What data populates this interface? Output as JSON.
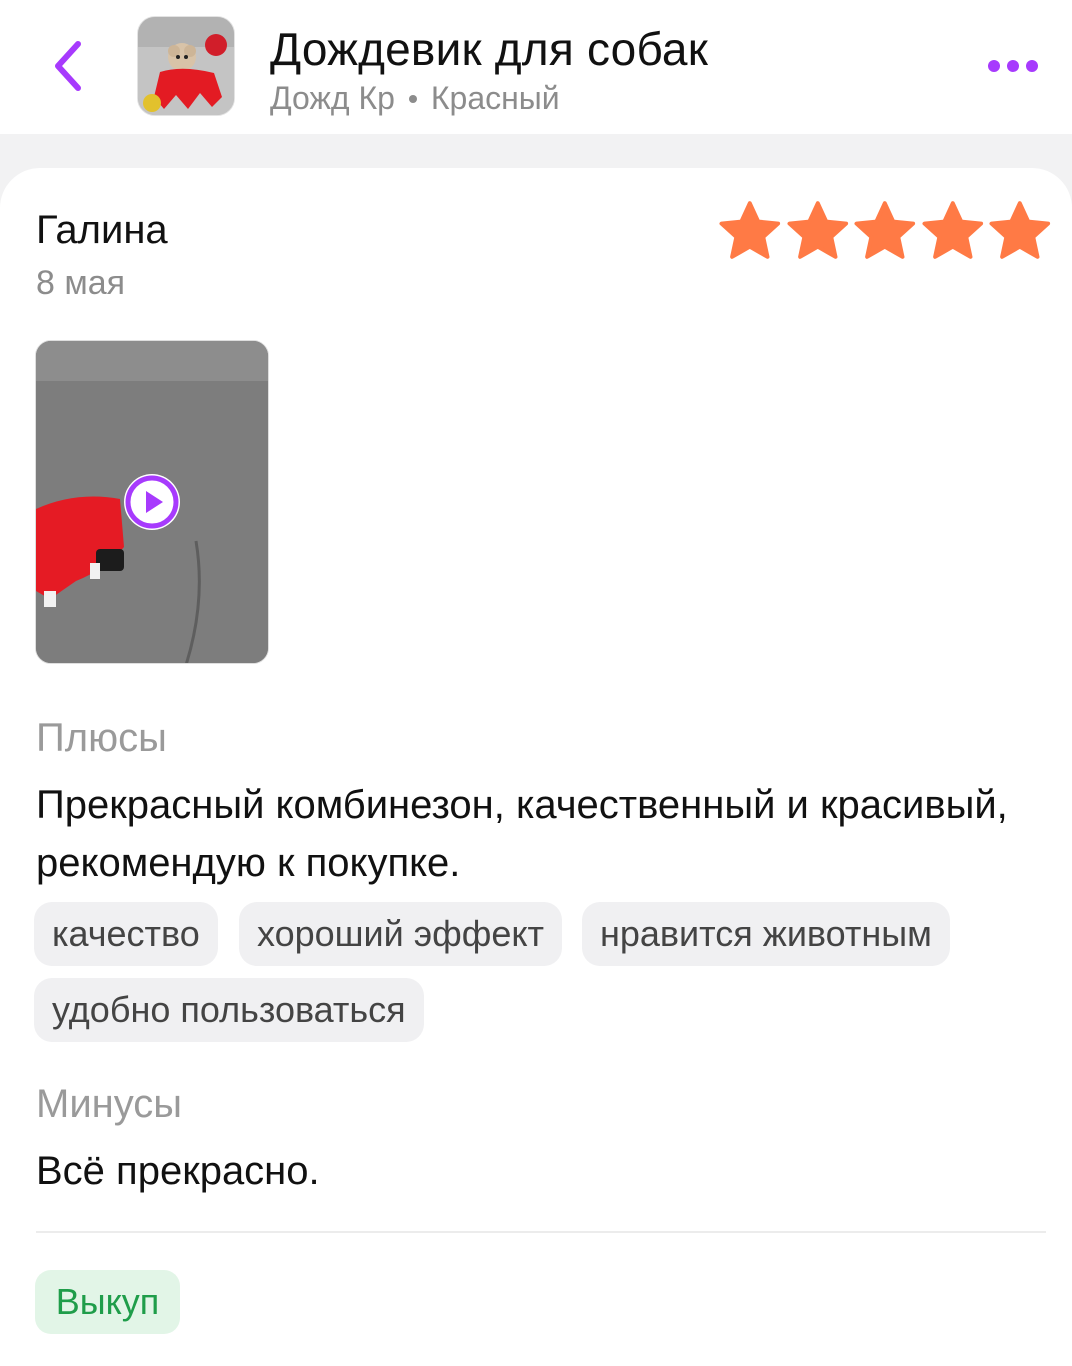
{
  "header": {
    "title": "Дождевик для собак",
    "variant": "Дожд Кр",
    "color": "Красный",
    "back_icon": "chevron-left-icon",
    "more_icon": "more-horizontal-icon",
    "accent_color": "#a73afd"
  },
  "review": {
    "author": "Галина",
    "date": "8 мая",
    "rating": 5,
    "max_rating": 5,
    "star_color": "#ff7a45",
    "media_type": "video",
    "play_icon": "play-icon",
    "pros_label": "Плюсы",
    "pros_text": "Прекрасный комбинезон, качественный и красивый, рекомендую к покупке.",
    "tags": [
      "качество",
      "хороший эффект",
      "нравится животным",
      "удобно пользоваться"
    ],
    "cons_label": "Минусы",
    "cons_text": "Всё прекрасно.",
    "badge": "Выкуп",
    "badge_color": "#1f9d4a"
  }
}
